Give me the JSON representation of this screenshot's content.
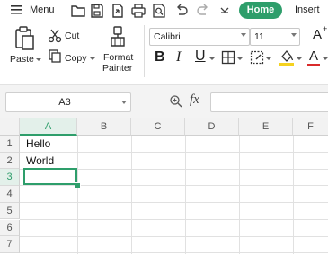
{
  "topbar": {
    "menu_label": "Menu",
    "quick_access": [
      "open-folder-icon",
      "save-icon",
      "export-icon",
      "print-icon",
      "print-preview-icon",
      "undo-icon",
      "redo-icon",
      "more-icon"
    ],
    "tabs": {
      "home": "Home",
      "insert": "Insert"
    }
  },
  "ribbon": {
    "paste_label": "Paste",
    "cut_label": "Cut",
    "copy_label": "Copy",
    "format_painter_label_1": "Format",
    "format_painter_label_2": "Painter",
    "font_name": "Calibri",
    "font_size": "11",
    "font_grow_symbol": "A",
    "bold": "B",
    "italic": "I",
    "underline": "U",
    "font_color_symbol": "A"
  },
  "colors": {
    "accent": "#2e9e6b",
    "fill_highlight": "#f5d21f",
    "font_color": "#d92b2b"
  },
  "formula_bar": {
    "name_box": "A3",
    "fx_label": "fx",
    "formula_value": ""
  },
  "sheet": {
    "columns": [
      "A",
      "B",
      "C",
      "D",
      "E",
      "F"
    ],
    "rows": [
      "1",
      "2",
      "3",
      "4",
      "5",
      "6",
      "7"
    ],
    "active_cell": "A3",
    "cells": {
      "A1": "Hello",
      "A2": "World"
    }
  }
}
